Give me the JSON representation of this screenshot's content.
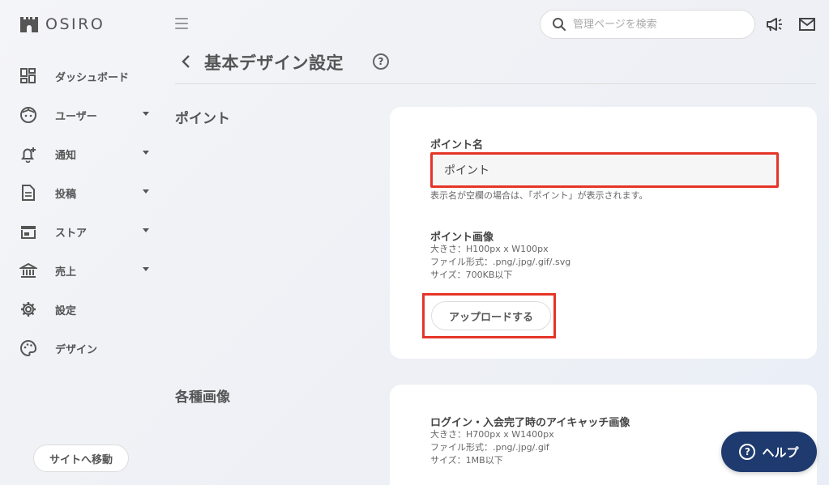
{
  "app": {
    "logo_text": "OSIRO"
  },
  "sidebar": {
    "items": [
      {
        "label": "ダッシュボード",
        "icon": "dashboard-icon",
        "has_submenu": false
      },
      {
        "label": "ユーザー",
        "icon": "user-face-icon",
        "has_submenu": true
      },
      {
        "label": "通知",
        "icon": "bell-plus-icon",
        "has_submenu": true
      },
      {
        "label": "投稿",
        "icon": "document-icon",
        "has_submenu": true
      },
      {
        "label": "ストア",
        "icon": "store-icon",
        "has_submenu": true
      },
      {
        "label": "売上",
        "icon": "bank-icon",
        "has_submenu": true
      },
      {
        "label": "設定",
        "icon": "gear-icon",
        "has_submenu": false
      },
      {
        "label": "デザイン",
        "icon": "palette-icon",
        "has_submenu": false
      }
    ],
    "site_button": "サイトへ移動"
  },
  "header": {
    "search_placeholder": "管理ページを検索"
  },
  "page": {
    "title": "基本デザイン設定",
    "help_symbol": "?"
  },
  "sections": {
    "point": {
      "label": "ポイント",
      "name_label": "ポイント名",
      "name_value": "ポイント",
      "name_hint": "表示名が空欄の場合は、「ポイント」が表示されます。",
      "image_label": "ポイント画像",
      "image_size": "大きさ：H100px x W100px",
      "image_format": "ファイル形式：.png/.jpg/.gif/.svg",
      "image_filesize": "サイズ：700KB以下",
      "upload_label": "アップロードする"
    },
    "images": {
      "label": "各種画像",
      "eyecatch_label": "ログイン・入会完了時のアイキャッチ画像",
      "eyecatch_size": "大きさ：H700px x W1400px",
      "eyecatch_format": "ファイル形式：.png/.jpg/.gif",
      "eyecatch_filesize": "サイズ：1MB以下"
    }
  },
  "help_button": {
    "label": "ヘルプ"
  },
  "colors": {
    "accent": "#1e3a6e",
    "highlight": "#e53528"
  }
}
